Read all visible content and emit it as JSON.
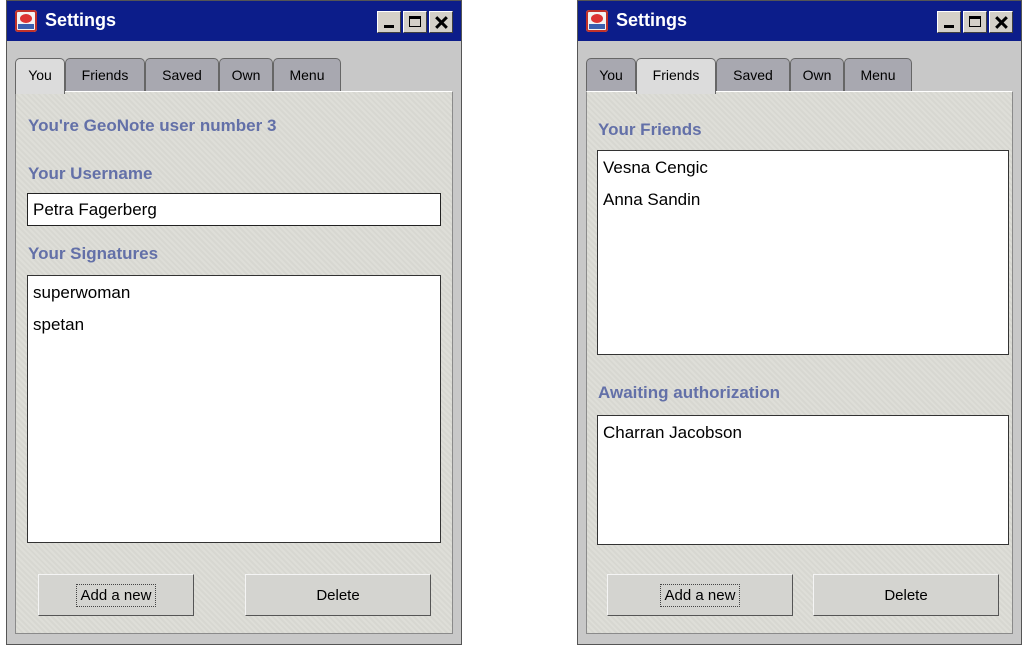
{
  "colors": {
    "titlebar": "#0c1d8a",
    "label": "#6370a8",
    "panel": "#dcdcd6"
  },
  "left_window": {
    "title": "Settings",
    "tabs": [
      "You",
      "Friends",
      "Saved",
      "Own",
      "Menu"
    ],
    "active_tab": "You",
    "user_number_text": "You're GeoNote user number 3",
    "username_label": "Your Username",
    "username_value": "Petra Fagerberg",
    "signatures_label": "Your Signatures",
    "signatures": [
      "superwoman",
      "spetan"
    ],
    "add_button": "Add a new",
    "delete_button": "Delete"
  },
  "right_window": {
    "title": "Settings",
    "tabs": [
      "You",
      "Friends",
      "Saved",
      "Own",
      "Menu"
    ],
    "active_tab": "Friends",
    "friends_label": "Your Friends",
    "friends": [
      "Vesna Cengic",
      "Anna Sandin"
    ],
    "awaiting_label": "Awaiting authorization",
    "awaiting": [
      "Charran Jacobson"
    ],
    "add_button": "Add a new",
    "delete_button": "Delete"
  },
  "icons": {
    "app": "geonote-app-icon",
    "minimize": "minimize-icon",
    "maximize": "maximize-icon",
    "close": "close-icon"
  }
}
